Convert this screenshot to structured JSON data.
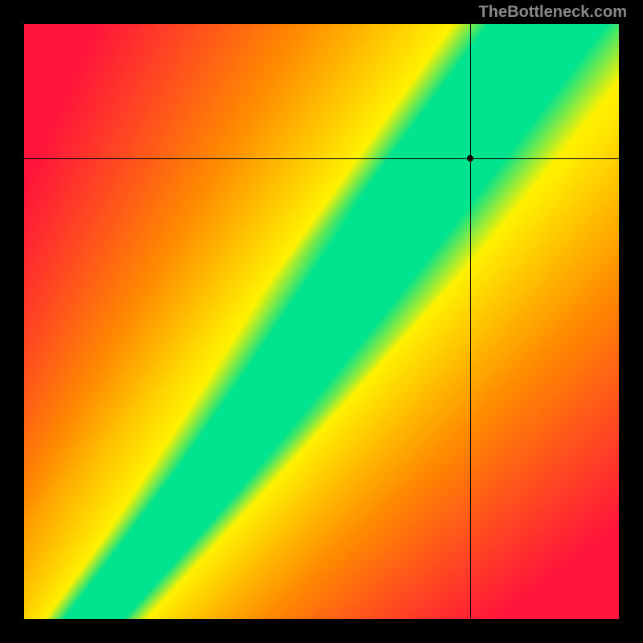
{
  "watermark": "TheBottleneck.com",
  "chart_data": {
    "type": "heatmap",
    "title": "",
    "xlabel": "",
    "ylabel": "",
    "xlim": [
      0,
      100
    ],
    "ylim": [
      0,
      100
    ],
    "grid": false,
    "legend": false,
    "crosshair": {
      "x": 75,
      "y": 77.5
    },
    "green_ridge": "A narrow near-diagonal band of optimal (green) values curving from bottom-left to top-right; values fall off to yellow then orange then red away from the band.",
    "color_scale": {
      "optimal": "#00e38f",
      "near": "#fff200",
      "mid": "#ff8c00",
      "far": "#ff143c"
    }
  }
}
